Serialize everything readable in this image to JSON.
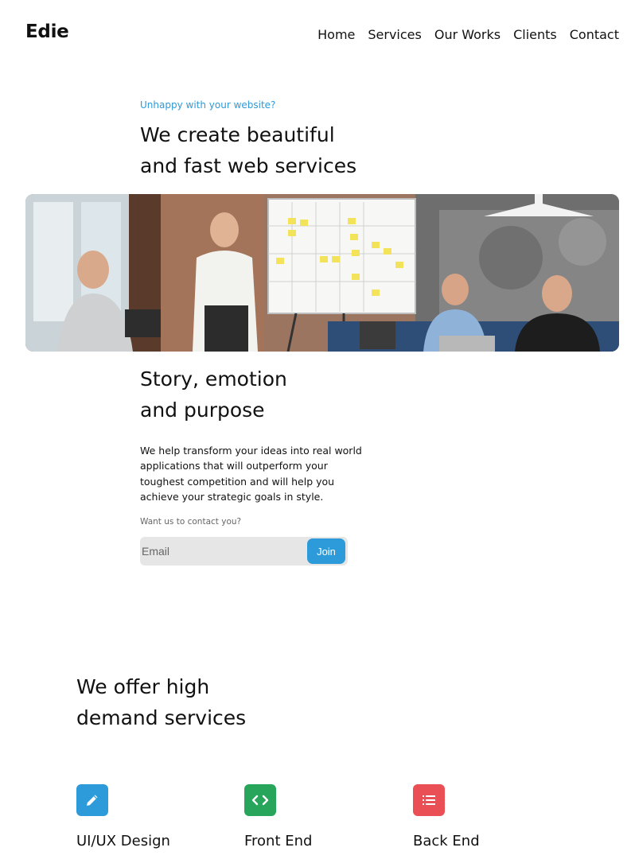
{
  "brand": {
    "logo": "Edie"
  },
  "nav": {
    "items": [
      "Home",
      "Services",
      "Our Works",
      "Clients",
      "Contact"
    ]
  },
  "hero": {
    "eyebrow": "Unhappy with your website?",
    "title_line1": "We create beautiful",
    "title_line2": "and fast web services"
  },
  "story": {
    "title_line1": "Story, emotion",
    "title_line2": "and purpose",
    "body": "We help transform your ideas into real world applications that will outperform your toughest competition and will help you achieve your strategic goals in style.",
    "contact_label": "Want us to contact you?",
    "email_placeholder": "Email",
    "join_label": "Join"
  },
  "services": {
    "title_line1": "We offer high",
    "title_line2": "demand services",
    "items": [
      {
        "label": "UI/UX Design",
        "icon": "pencil-icon",
        "color": "#2d9ad9"
      },
      {
        "label": "Front End",
        "icon": "code-icon",
        "color": "#27a55a"
      },
      {
        "label": "Back End",
        "icon": "list-icon",
        "color": "#ea4f55"
      }
    ]
  },
  "colors": {
    "accent": "#2d9ad9",
    "green": "#27a55a",
    "red": "#ea4f55"
  }
}
